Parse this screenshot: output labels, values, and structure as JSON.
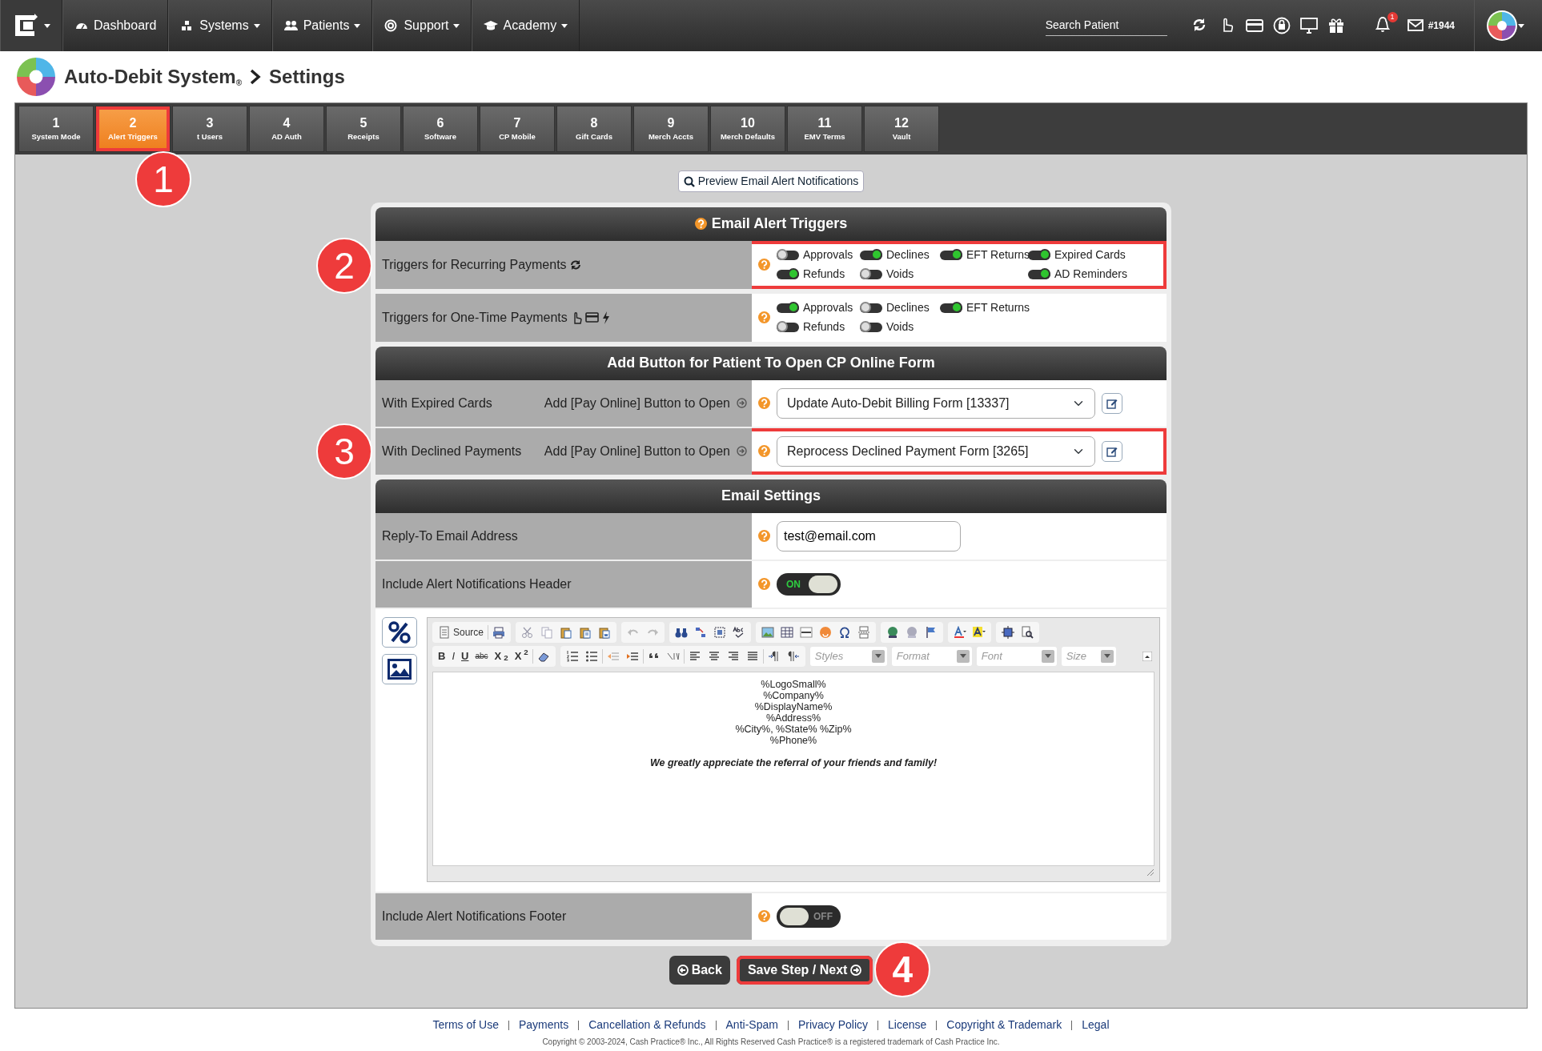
{
  "navbar": {
    "menu": [
      {
        "label": "Dashboard",
        "dropdown": false,
        "kind": "dashboard"
      },
      {
        "label": "Systems",
        "dropdown": true,
        "kind": "systems"
      },
      {
        "label": "Patients",
        "dropdown": true,
        "kind": "patients"
      },
      {
        "label": "Support",
        "dropdown": true,
        "kind": "support"
      },
      {
        "label": "Academy",
        "dropdown": true,
        "kind": "academy"
      }
    ],
    "search": {
      "placeholder": "Search Patient"
    },
    "notifications": "1",
    "message_id": "#1944"
  },
  "page_title": {
    "system": "Auto-Debit System$_{®}$",
    "page": "Settings"
  },
  "tabs": [
    {
      "number": "1",
      "label": "System Mode",
      "selected": false,
      "highlighted": false
    },
    {
      "number": "2",
      "label": "Alert Triggers",
      "selected": true,
      "highlighted": true,
      "callout": "1"
    },
    {
      "number": "3",
      "label": "t Users",
      "selected": false,
      "highlighted": false
    },
    {
      "number": "4",
      "label": "AD Auth",
      "selected": false,
      "highlighted": false
    },
    {
      "number": "5",
      "label": "Receipts",
      "selected": false,
      "highlighted": false
    },
    {
      "number": "6",
      "label": "Software",
      "selected": false,
      "highlighted": false
    },
    {
      "number": "7",
      "label": "CP Mobile",
      "selected": false,
      "highlighted": false
    },
    {
      "number": "8",
      "label": "Gift Cards",
      "selected": false,
      "highlighted": false
    },
    {
      "number": "9",
      "label": "Merch Accts",
      "selected": false,
      "highlighted": false
    },
    {
      "number": "10",
      "label": "Merch Defaults",
      "selected": false,
      "highlighted": false
    },
    {
      "number": "11",
      "label": "EMV Terms",
      "selected": false,
      "highlighted": false
    },
    {
      "number": "12",
      "label": "Vault",
      "selected": false,
      "highlighted": false
    }
  ],
  "preview_button": "Preview Email Alert Notifications",
  "triggers": {
    "title": "Email Alert Triggers",
    "rows": [
      {
        "label": "Triggers for Recurring Payments",
        "kind": "recurring",
        "highlighted": true,
        "callout": "2",
        "columns": [
          [
            {
              "label": "Approvals",
              "on": false
            },
            {
              "label": "Refunds",
              "on": true
            }
          ],
          [
            {
              "label": "Declines",
              "on": true
            },
            {
              "label": "Voids",
              "on": false
            }
          ],
          [
            {
              "label": "EFT Returns",
              "on": true
            }
          ],
          [
            {
              "label": "Expired Cards",
              "on": true
            },
            {
              "label": "AD Reminders",
              "on": true
            }
          ]
        ]
      },
      {
        "label": "Triggers for One-Time Payments",
        "kind": "one_time",
        "highlighted": false,
        "columns": [
          [
            {
              "label": "Approvals",
              "on": true
            },
            {
              "label": "Refunds",
              "on": false
            }
          ],
          [
            {
              "label": "Declines",
              "on": false
            },
            {
              "label": "Voids",
              "on": false
            }
          ],
          [
            {
              "label": "EFT Returns",
              "on": true
            }
          ]
        ]
      }
    ]
  },
  "online_form": {
    "title": "Add Button for Patient To Open CP Online Form",
    "rows": [
      {
        "label": "With Expired Cards",
        "action": "Add [Pay Online] Button to Open",
        "value": "Update Auto-Debit Billing Form [13337]",
        "highlighted": false
      },
      {
        "label": "With Declined Payments",
        "action": "Add [Pay Online] Button to Open",
        "value": "Reprocess Declined Payment Form [3265]",
        "highlighted": true,
        "callout": "3"
      }
    ]
  },
  "email_settings": {
    "title": "Email Settings",
    "reply_to": {
      "label": "Reply-To Email Address",
      "value": "test@email.com"
    },
    "header": {
      "label": "Include Alert Notifications Header",
      "on": true,
      "toggle_text": "ON"
    },
    "editor": {
      "source_label": "Source",
      "format_buttons": [
        "B",
        "I",
        "U",
        "abc",
        "X$_{2}$",
        "X$^{2}$"
      ],
      "dropdowns": [
        "Styles",
        "Format",
        "Font",
        "Size"
      ],
      "lines": [
        "%LogoSmall%",
        "%Company%",
        "%DisplayName%",
        "%Address%",
        "%City%, %State% %Zip%",
        "%Phone%"
      ],
      "closing": "We greatly appreciate the referral of your friends and family!"
    },
    "footer": {
      "label": "Include Alert Notifications Footer",
      "on": false,
      "toggle_text": "OFF"
    }
  },
  "buttons": {
    "back": "Back",
    "save": {
      "label": "Save Step / Next",
      "highlighted": true,
      "callout": "4"
    }
  },
  "footer_links": [
    "Terms of Use",
    "Payments",
    "Cancellation & Refunds",
    "Anti-Spam",
    "Privacy Policy",
    "License",
    "Copyright & Trademark",
    "Legal"
  ],
  "copyright": "Copyright © 2003-2024, Cash Practice® Inc., All Rights Reserved Cash Practice® is a registered trademark of Cash Practice Inc."
}
